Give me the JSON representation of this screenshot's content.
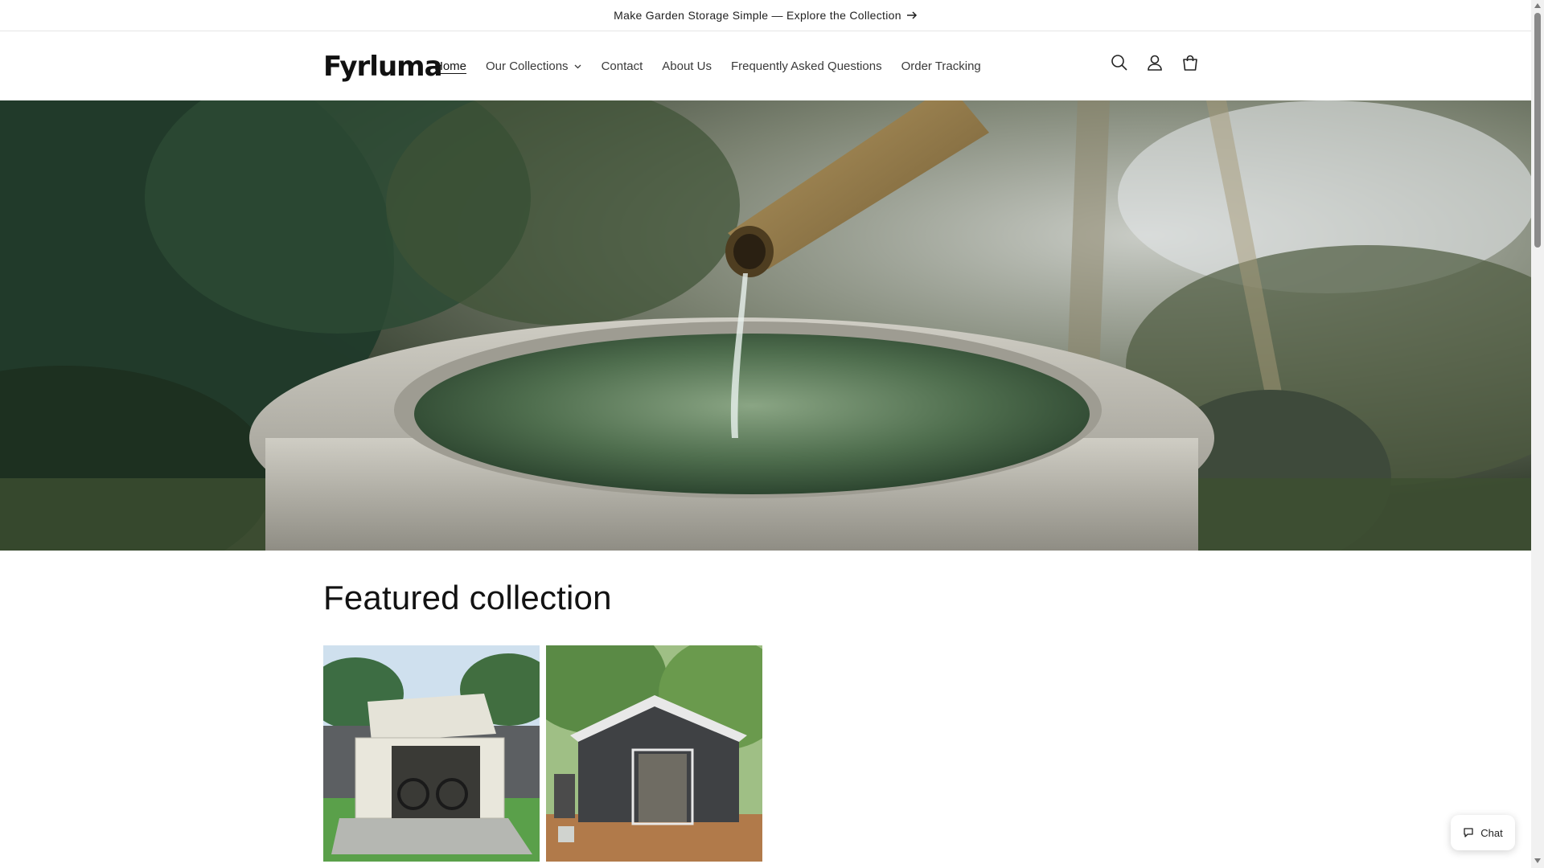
{
  "announcement": {
    "text": "Make Garden Storage Simple — Explore the Collection",
    "arrow_icon": "arrow-right-icon"
  },
  "header": {
    "logo": "Fyrluma",
    "nav": [
      {
        "label": "Home",
        "active": true
      },
      {
        "label": "Our Collections",
        "has_dropdown": true
      },
      {
        "label": "Contact"
      },
      {
        "label": "About Us"
      },
      {
        "label": "Frequently Asked Questions"
      },
      {
        "label": "Order Tracking"
      }
    ],
    "icons": [
      "search-icon",
      "account-icon",
      "cart-icon"
    ]
  },
  "hero": {
    "image": "bamboo-water-fountain-stone-basin"
  },
  "featured": {
    "title": "Featured collection",
    "products": [
      {
        "image": "open-metal-bike-shed-cream"
      },
      {
        "image": "dark-gray-metal-garden-shed"
      }
    ]
  },
  "chat": {
    "label": "Chat",
    "icon": "chat-bubble-icon"
  },
  "colors": {
    "text": "#121212",
    "border": "#e6e6e6",
    "background": "#ffffff"
  }
}
